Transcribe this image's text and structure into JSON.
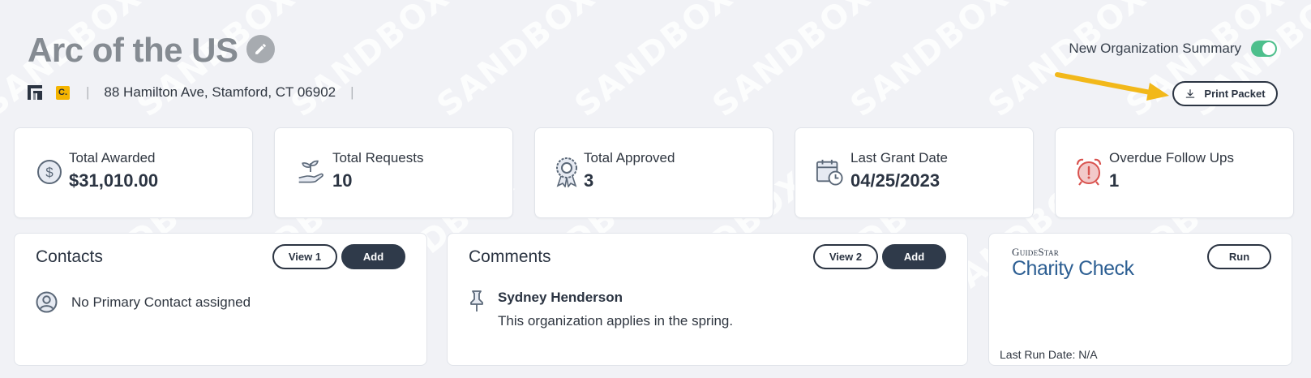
{
  "watermark": {
    "text": "SANDBOX"
  },
  "organization": {
    "name": "Arc of the US",
    "address": "88 Hamilton Ave, Stamford, CT 06902",
    "badge": "C.",
    "separator": "|"
  },
  "summary_toggle": {
    "label": "New Organization Summary",
    "enabled": true
  },
  "print_button": {
    "label": "Print Packet"
  },
  "stats": [
    {
      "label": "Total Awarded",
      "value": "$31,010.00",
      "icon": "dollar-circle-icon"
    },
    {
      "label": "Total Requests",
      "value": "10",
      "icon": "seedling-hand-icon"
    },
    {
      "label": "Total Approved",
      "value": "3",
      "icon": "award-badge-icon"
    },
    {
      "label": "Last Grant Date",
      "value": "04/25/2023",
      "icon": "calendar-clock-icon"
    },
    {
      "label": "Overdue Follow Ups",
      "value": "1",
      "icon": "alarm-clock-icon"
    }
  ],
  "contacts": {
    "title": "Contacts",
    "view_label": "View 1",
    "add_label": "Add",
    "empty_text": "No Primary Contact assigned"
  },
  "comments": {
    "title": "Comments",
    "view_label": "View 2",
    "add_label": "Add",
    "items": [
      {
        "author": "Sydney Henderson",
        "text": "This organization applies in the spring."
      }
    ]
  },
  "charity_check": {
    "logo_small": "GuideStar",
    "logo_big": "Charity Check",
    "run_label": "Run",
    "last_run": "Last Run Date: N/A"
  },
  "colors": {
    "accent_dark": "#2f3a4a",
    "toggle_on": "#4dbf8c",
    "alert_red": "#d9534f",
    "arrow_yellow": "#f2b81a"
  }
}
